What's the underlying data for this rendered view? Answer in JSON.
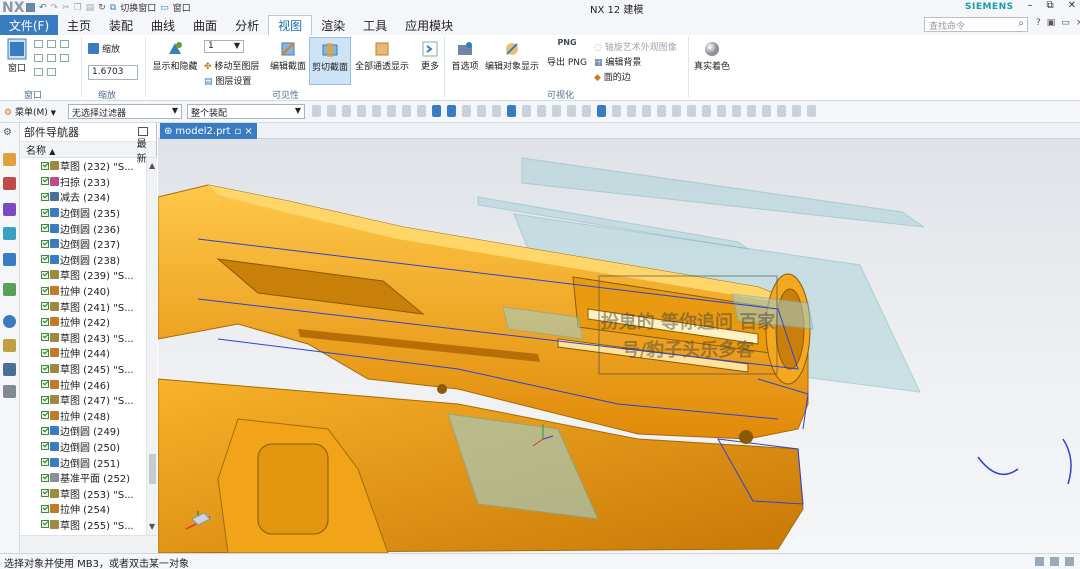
{
  "app": {
    "logo": "NX",
    "title": "NX 12   建模",
    "brand": "SIEMENS",
    "qat": {
      "switch_window": "切换窗口",
      "window": "窗口"
    }
  },
  "menu": {
    "file": "文件(F)",
    "tabs": [
      "主页",
      "装配",
      "曲线",
      "曲面",
      "分析",
      "视图",
      "渲染",
      "工具",
      "应用模块"
    ],
    "active_tab": "视图",
    "search_placeholder": "查找命令"
  },
  "ribbon": {
    "window_btn": "窗口",
    "zoom_label": "缩放",
    "zoom_value": "1.6703",
    "layer_value": "1",
    "show_hide": "显示和隐藏",
    "move_to_layer": "移动至图层",
    "layer_settings": "图层设置",
    "edit_section": "编辑截面",
    "clip_section": "剪切截面",
    "show_all_transparent": "全部通透显示",
    "more": "更多",
    "preferences": "首选项",
    "edit_object_display": "编辑对象显示",
    "export_png": "导出 PNG",
    "png_icon_text": "PNG",
    "rotate_art_view": "轴旋艺术外观图像",
    "edit_background": "编辑背景",
    "faces_edges": "面的边",
    "true_shading": "真实着色",
    "groups": [
      "窗口",
      "缩放",
      "可见性",
      "可视化"
    ]
  },
  "toolbar2": {
    "menu": "菜单(M)",
    "filter": "无选择过滤器",
    "assembly": "整个装配"
  },
  "navigator": {
    "title": "部件导航器",
    "col_name": "名称",
    "col_latest": "最新",
    "items": [
      {
        "label": "草图 (232) \"S...",
        "type": "sketch"
      },
      {
        "label": "扫掠 (233)",
        "type": "sweep"
      },
      {
        "label": "减去 (234)",
        "type": "subtract"
      },
      {
        "label": "边倒圆 (235)",
        "type": "blend"
      },
      {
        "label": "边倒圆 (236)",
        "type": "blend"
      },
      {
        "label": "边倒圆 (237)",
        "type": "blend"
      },
      {
        "label": "边倒圆 (238)",
        "type": "blend"
      },
      {
        "label": "草图 (239) \"S...",
        "type": "sketch"
      },
      {
        "label": "拉伸 (240)",
        "type": "extrude"
      },
      {
        "label": "草图 (241) \"S...",
        "type": "sketch"
      },
      {
        "label": "拉伸 (242)",
        "type": "extrude"
      },
      {
        "label": "草图 (243) \"S...",
        "type": "sketch"
      },
      {
        "label": "拉伸 (244)",
        "type": "extrude"
      },
      {
        "label": "草图 (245) \"S...",
        "type": "sketch"
      },
      {
        "label": "拉伸 (246)",
        "type": "extrude"
      },
      {
        "label": "草图 (247) \"S...",
        "type": "sketch"
      },
      {
        "label": "拉伸 (248)",
        "type": "extrude"
      },
      {
        "label": "边倒圆 (249)",
        "type": "blend"
      },
      {
        "label": "边倒圆 (250)",
        "type": "blend"
      },
      {
        "label": "边倒圆 (251)",
        "type": "blend"
      },
      {
        "label": "基准平面 (252)",
        "type": "datum"
      },
      {
        "label": "草图 (253) \"S...",
        "type": "sketch"
      },
      {
        "label": "拉伸 (254)",
        "type": "extrude"
      },
      {
        "label": "草图 (255) \"S...",
        "type": "sketch"
      }
    ]
  },
  "doc_tab": "model2.prt",
  "watermark": "扮鬼的 等你追问 百家号/豹子头乐多客",
  "status": "选择对象并使用 MB3，或者双击某一对象",
  "colors": {
    "accent": "#3a7cc1",
    "part": "#f2a20f",
    "plane": "#7ec0c4",
    "sketch_curve": "#2e43d6"
  }
}
